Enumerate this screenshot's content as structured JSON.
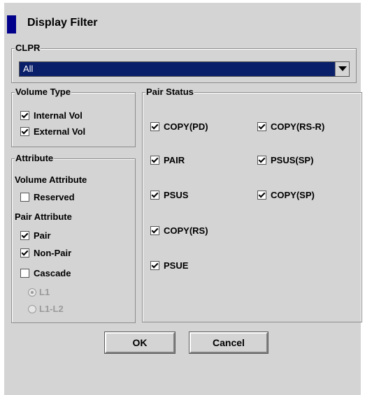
{
  "dialog": {
    "title": "Display Filter"
  },
  "clpr": {
    "legend": "CLPR",
    "selected": "All"
  },
  "volume_type": {
    "legend": "Volume Type",
    "items": [
      {
        "label": "Internal Vol",
        "checked": true
      },
      {
        "label": "External Vol",
        "checked": true
      }
    ]
  },
  "attribute": {
    "legend": "Attribute",
    "volume_attribute_label": "Volume Attribute",
    "reserved": {
      "label": "Reserved",
      "checked": false
    },
    "pair_attribute_label": "Pair Attribute",
    "pair_items": [
      {
        "label": "Pair",
        "checked": true
      },
      {
        "label": "Non-Pair",
        "checked": true
      },
      {
        "label": "Cascade",
        "checked": false
      }
    ],
    "radios": [
      {
        "label": "L1",
        "selected": true,
        "enabled": false
      },
      {
        "label": "L1-L2",
        "selected": false,
        "enabled": false
      }
    ]
  },
  "pair_status": {
    "legend": "Pair Status",
    "items": [
      {
        "label": "COPY(PD)",
        "checked": true
      },
      {
        "label": "COPY(RS-R)",
        "checked": true
      },
      {
        "label": "PAIR",
        "checked": true
      },
      {
        "label": "PSUS(SP)",
        "checked": true
      },
      {
        "label": "PSUS",
        "checked": true
      },
      {
        "label": "COPY(SP)",
        "checked": true
      },
      {
        "label": "COPY(RS)",
        "checked": true
      },
      {
        "label": "PSUE",
        "checked": true
      }
    ]
  },
  "buttons": {
    "ok": "OK",
    "cancel": "Cancel"
  },
  "colors": {
    "panel": "#d4d4d4",
    "title_mark": "#00008b",
    "select_bg": "#0a1f6a"
  }
}
